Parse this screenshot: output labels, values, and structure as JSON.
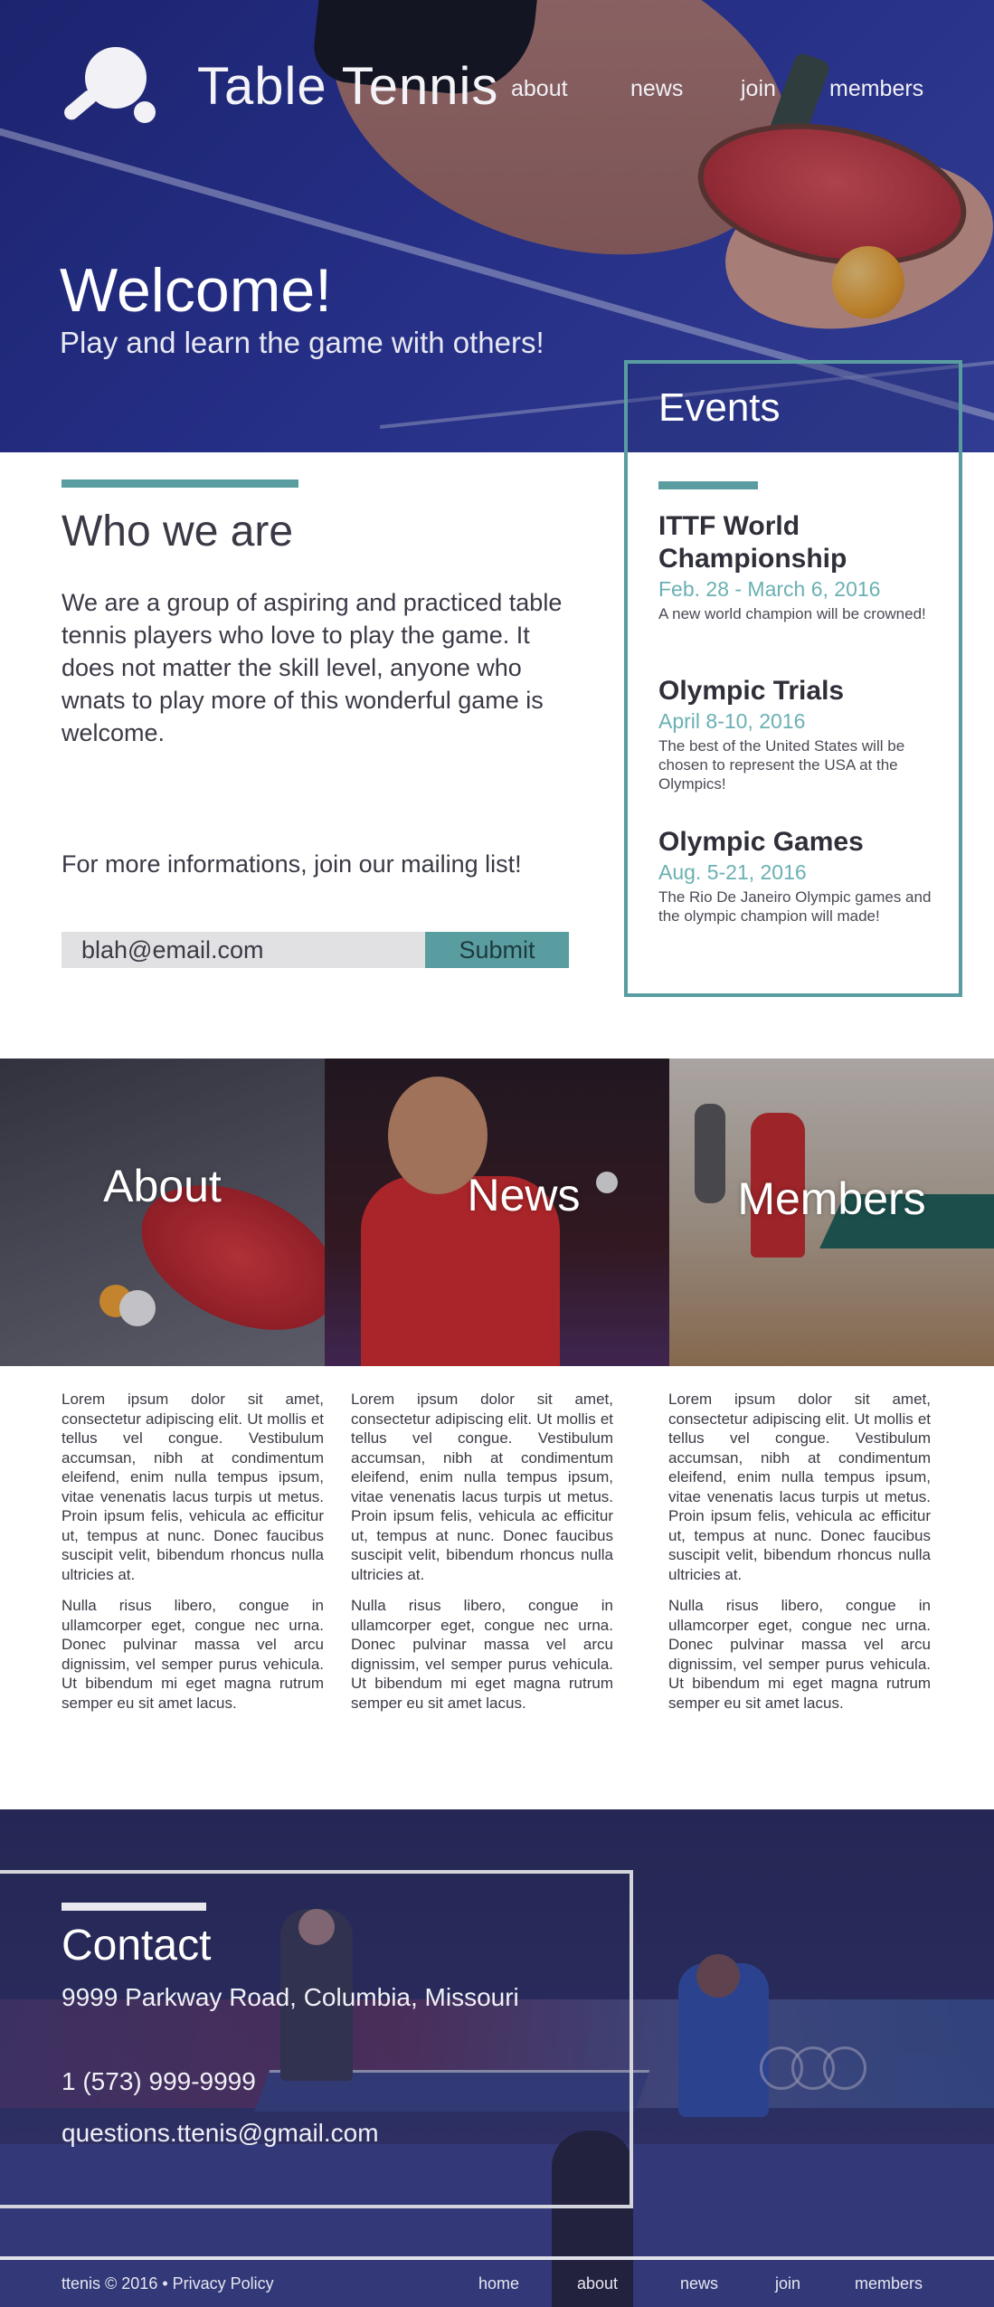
{
  "header": {
    "site_title": "Table Tennis",
    "logo_icon": "ping-pong-paddle-icon",
    "nav": [
      "about",
      "news",
      "join",
      "members"
    ]
  },
  "hero": {
    "welcome": "Welcome!",
    "subtitle": "Play and learn the game with others!"
  },
  "who": {
    "title": "Who we are",
    "text": "We are a group of aspiring and practiced table tennis players who love to play the game. It does not matter the skill level, anyone who wnats to play more of this wonderful game is welcome.",
    "mailing_text": "For more informations, join our mailing list!",
    "email_value": "blah@email.com",
    "submit_label": "Submit"
  },
  "events": {
    "title": "Events",
    "items": [
      {
        "name": "ITTF World Championship",
        "date": "Feb. 28 - March 6, 2016",
        "desc": "A new world champion will be crowned!"
      },
      {
        "name": "Olympic Trials",
        "date": "April 8-10, 2016",
        "desc": "The best of the United States will be chosen to represent the USA at the Olympics!"
      },
      {
        "name": "Olympic Games",
        "date": "Aug. 5-21, 2016",
        "desc": "The Rio De Janeiro Olympic games and the olympic champion will made!"
      }
    ]
  },
  "tiles": [
    "About",
    "News",
    "Members"
  ],
  "lorem": {
    "p1": "Lorem ipsum dolor sit amet, consectetur adipiscing elit. Ut mollis et tellus vel congue. Vestibulum accumsan, nibh at condimentum eleifend, enim nulla tempus ipsum, vitae venenatis lacus turpis ut metus. Proin ipsum felis, vehicula ac efficitur ut, tempus at nunc. Donec faucibus suscipit velit, bibendum rhoncus nulla ultricies at.",
    "p2": "Nulla risus libero, congue in ullamcorper eget, congue nec urna. Donec pulvinar massa vel arcu dignissim, vel semper purus vehicula. Ut bibendum mi eget magna rutrum semper eu sit amet lacus."
  },
  "contact": {
    "title": "Contact",
    "address": "9999 Parkway Road, Columbia, Missouri",
    "phone": "1 (573) 999-9999",
    "email": "questions.ttenis@gmail.com"
  },
  "footer": {
    "copyright": "ttenis © 2016 • Privacy Policy",
    "nav": [
      "home",
      "about",
      "news",
      "join",
      "members"
    ]
  },
  "colors": {
    "accent": "#5a9da1",
    "hero_blue": "#2a3696",
    "text_dark": "#3a3a46"
  }
}
